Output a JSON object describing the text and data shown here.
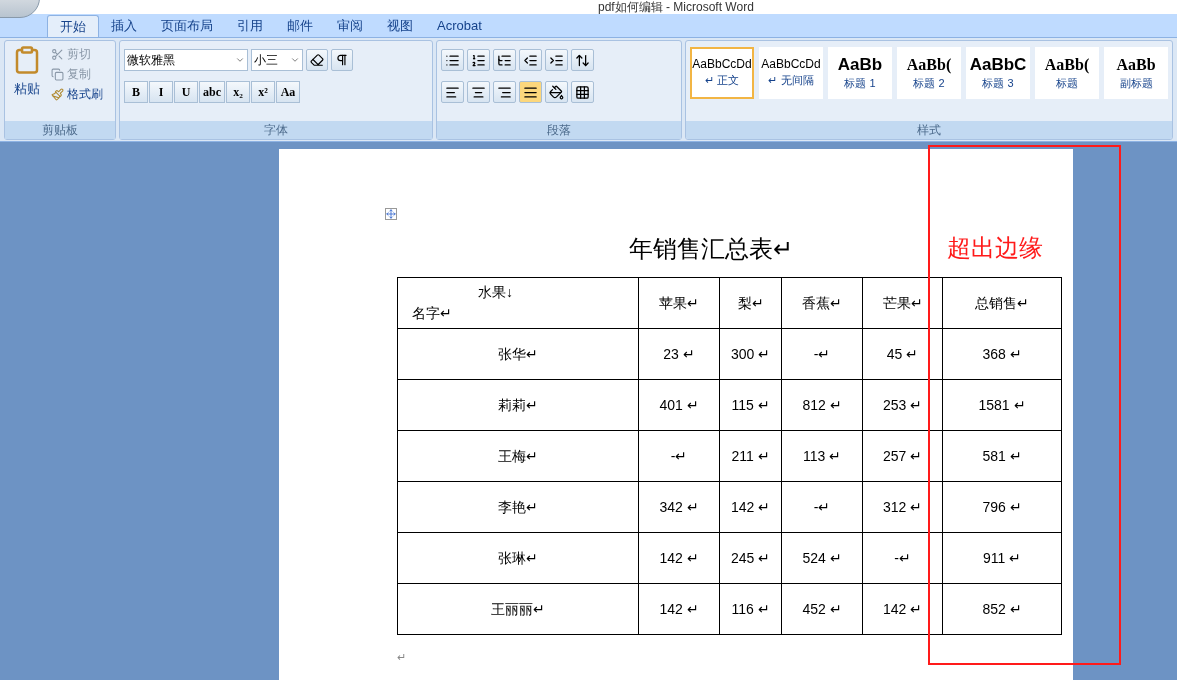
{
  "window": {
    "title": "pdf如何编辑 - Microsoft Word"
  },
  "tabs": [
    {
      "label": "开始",
      "selected": true
    },
    {
      "label": "插入",
      "selected": false
    },
    {
      "label": "页面布局",
      "selected": false
    },
    {
      "label": "引用",
      "selected": false
    },
    {
      "label": "邮件",
      "selected": false
    },
    {
      "label": "审阅",
      "selected": false
    },
    {
      "label": "视图",
      "selected": false
    },
    {
      "label": "Acrobat",
      "selected": false
    }
  ],
  "clipboard": {
    "paste": "粘贴",
    "cut": "剪切",
    "copy": "复制",
    "format_painter": "格式刷",
    "label": "剪贴板"
  },
  "font": {
    "name": "微软雅黑",
    "size": "小三",
    "label": "字体",
    "buttons": [
      "B",
      "I",
      "U",
      "abc",
      "x₂",
      "x²",
      "Aa"
    ]
  },
  "paragraph": {
    "label": "段落"
  },
  "styles": {
    "label": "样式",
    "items": [
      {
        "sample": "AaBbCcDd",
        "name": "↵ 正文",
        "kind": "normal",
        "selected": true
      },
      {
        "sample": "AaBbCcDd",
        "name": "↵ 无间隔",
        "kind": "normal",
        "selected": false
      },
      {
        "sample": "AaBb",
        "name": "标题 1",
        "kind": "heading",
        "selected": false
      },
      {
        "sample": "AaBb(",
        "name": "标题 2",
        "kind": "serif",
        "selected": false
      },
      {
        "sample": "AaBbC",
        "name": "标题 3",
        "kind": "heading",
        "selected": false
      },
      {
        "sample": "AaBb(",
        "name": "标题",
        "kind": "serif",
        "selected": false
      },
      {
        "sample": "AaBb",
        "name": "副标题",
        "kind": "serif",
        "selected": false
      }
    ]
  },
  "document": {
    "title": "年销售汇总表↵",
    "columns": [
      {
        "lines": [
          "水果↓",
          "名字↵"
        ]
      },
      {
        "lines": [
          "苹果↵"
        ]
      },
      {
        "lines": [
          "梨↵"
        ]
      },
      {
        "lines": [
          "香蕉↵"
        ]
      },
      {
        "lines": [
          "芒果↵"
        ]
      },
      {
        "lines": [
          "总销售↵"
        ]
      }
    ],
    "rows": [
      [
        "张华↵",
        "23 ↵",
        "300 ↵",
        "-↵",
        "45 ↵",
        "368 ↵"
      ],
      [
        "莉莉↵",
        "401 ↵",
        "115 ↵",
        "812 ↵",
        "253 ↵",
        "1581 ↵"
      ],
      [
        "王梅↵",
        "-↵",
        "211 ↵",
        "113 ↵",
        "257 ↵",
        "581 ↵"
      ],
      [
        "李艳↵",
        "342 ↵",
        "142 ↵",
        "-↵",
        "312 ↵",
        "796 ↵"
      ],
      [
        "张琳↵",
        "142 ↵",
        "245 ↵",
        "524 ↵",
        "-↵",
        "911 ↵"
      ],
      [
        "王丽丽↵",
        "142 ↵",
        "116 ↵",
        "452 ↵",
        "142 ↵",
        "852 ↵"
      ]
    ],
    "end_mark": "↵"
  },
  "annotation": {
    "text": "超出边缘"
  }
}
